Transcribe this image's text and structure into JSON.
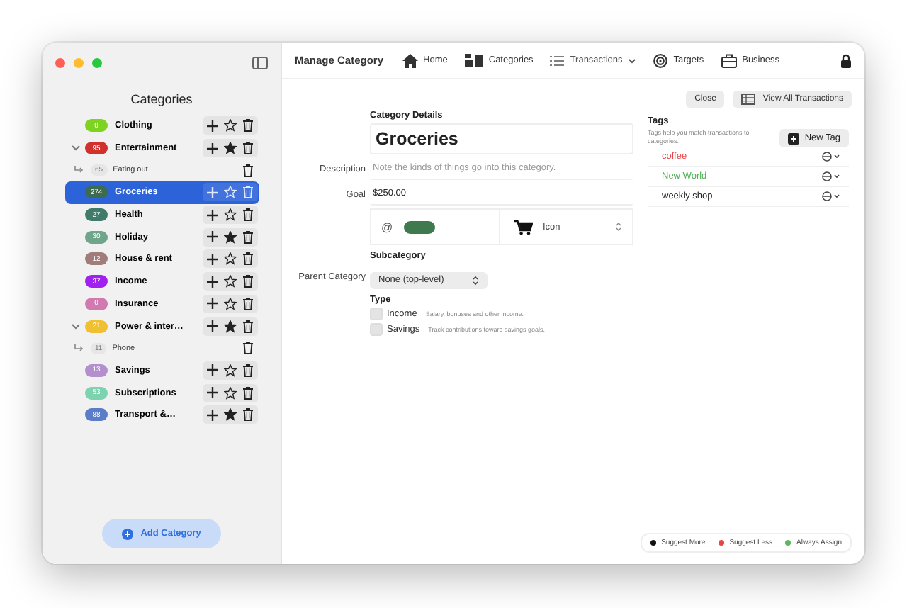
{
  "sidebar": {
    "title": "Categories",
    "categories": [
      {
        "count": "0",
        "name": "Clothing",
        "color": "#7ed321",
        "starred": false,
        "selected": false
      },
      {
        "count": "95",
        "name": "Entertainment",
        "color": "#d0312d",
        "starred": true,
        "selected": false,
        "expanded": true,
        "children": [
          {
            "count": "65",
            "name": "Eating out",
            "selected": false
          }
        ]
      },
      {
        "count": "274",
        "name": "Groceries",
        "color": "#3d6b4f",
        "starred": false,
        "selected": true
      },
      {
        "count": "27",
        "name": "Health",
        "color": "#3f7a6a",
        "starred": false,
        "selected": false
      },
      {
        "count": "30",
        "name": "Holiday",
        "color": "#6fa58a",
        "starred": true,
        "selected": false
      },
      {
        "count": "12",
        "name": "House & rent",
        "color": "#a07d7a",
        "starred": false,
        "selected": false
      },
      {
        "count": "37",
        "name": "Income",
        "color": "#a020f0",
        "starred": false,
        "selected": false
      },
      {
        "count": "0",
        "name": "Insurance",
        "color": "#d07ab0",
        "starred": false,
        "selected": false
      },
      {
        "count": "21",
        "name": "Power & inter…",
        "color": "#f0c030",
        "starred": true,
        "selected": false,
        "expanded": true,
        "children": [
          {
            "count": "11",
            "name": "Phone",
            "selected": false
          }
        ]
      },
      {
        "count": "13",
        "name": "Savings",
        "color": "#b48fd0",
        "starred": false,
        "selected": false
      },
      {
        "count": "53",
        "name": "Subscriptions",
        "color": "#7dd3b0",
        "starred": false,
        "selected": false
      },
      {
        "count": "88",
        "name": "Transport &…",
        "color": "#5b7cc9",
        "starred": true,
        "selected": false
      }
    ],
    "add_button": "Add Category"
  },
  "toolbar": {
    "title": "Manage Category",
    "nav": [
      {
        "kind": "home",
        "label": "Home"
      },
      {
        "kind": "categories",
        "label": "Categories"
      },
      {
        "kind": "transactions",
        "label": "Transactions"
      },
      {
        "kind": "targets",
        "label": "Targets"
      },
      {
        "kind": "business",
        "label": "Business"
      }
    ]
  },
  "actions": [
    "Close",
    "View All Transactions"
  ],
  "details": {
    "heading": "Category Details",
    "name": "Groceries",
    "description_label": "Description",
    "description_placeholder": "Note the kinds of things go into this category.",
    "goal_label": "Goal",
    "goal": "$250.00",
    "at_symbol": "@",
    "color": "#3f7a4e",
    "icon_label": "Icon"
  },
  "subcategory": {
    "heading": "Subcategory",
    "parent_label": "Parent Category",
    "parent_value": "None (top-level)"
  },
  "type": {
    "heading": "Type",
    "options": [
      {
        "label": "Income",
        "hint": "Salary, bonuses and other income.",
        "checked": false
      },
      {
        "label": "Savings",
        "hint": "Track contributions toward savings goals.",
        "checked": false
      }
    ]
  },
  "tags": {
    "heading": "Tags",
    "hint": "Tags help you match transactions to categories.",
    "new_button": "New Tag",
    "items": [
      {
        "name": "coffee",
        "color": "#e8474a"
      },
      {
        "name": "New World",
        "color": "#4caf50"
      },
      {
        "name": "weekly shop",
        "color": "#222222"
      }
    ]
  },
  "legend": [
    {
      "label": "Suggest More",
      "color": "#111111"
    },
    {
      "label": "Suggest Less",
      "color": "#e84545"
    },
    {
      "label": "Always Assign",
      "color": "#5cb85c"
    }
  ]
}
